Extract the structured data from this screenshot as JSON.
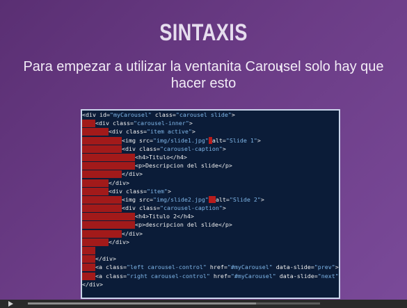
{
  "slide": {
    "title": "SINTAXIS",
    "subtitle_line1": "Para empezar a utilizar la ventanita Carousel solo hay que",
    "subtitle_line2": "hacer esto"
  },
  "code": [
    {
      "indent": 0,
      "segments": [
        {
          "t": "<div id=",
          "c": "tag"
        },
        {
          "t": "\"myCarousel\"",
          "c": "str"
        },
        {
          "t": " class=",
          "c": "attr"
        },
        {
          "t": "\"carousel slide\"",
          "c": "str"
        },
        {
          "t": ">",
          "c": "tag"
        }
      ]
    },
    {
      "indent": 1,
      "segments": [
        {
          "t": "<div class=",
          "c": "tag"
        },
        {
          "t": "\"carousel-inner\"",
          "c": "str"
        },
        {
          "t": ">",
          "c": "tag"
        }
      ]
    },
    {
      "indent": 2,
      "segments": [
        {
          "t": "<div class=",
          "c": "tag"
        },
        {
          "t": "\"item active\"",
          "c": "str"
        },
        {
          "t": ">",
          "c": "tag"
        }
      ]
    },
    {
      "indent": 3,
      "segments": [
        {
          "t": "<img src=",
          "c": "tag"
        },
        {
          "t": "\"img/slide1.jpg\"",
          "c": "str"
        },
        {
          "t": " ",
          "c": "err"
        },
        {
          "t": "alt=",
          "c": "attr"
        },
        {
          "t": "\"Slide 1\"",
          "c": "str"
        },
        {
          "t": ">",
          "c": "tag"
        }
      ]
    },
    {
      "indent": 3,
      "segments": [
        {
          "t": "<div class=",
          "c": "tag"
        },
        {
          "t": "\"carousel-caption\"",
          "c": "str"
        },
        {
          "t": ">",
          "c": "tag"
        }
      ]
    },
    {
      "indent": 4,
      "segments": [
        {
          "t": "<h4>Titulo</h4>",
          "c": "tag"
        }
      ]
    },
    {
      "indent": 4,
      "segments": [
        {
          "t": "<p>Descripcion del slide</p>",
          "c": "tag"
        }
      ]
    },
    {
      "indent": 3,
      "segments": [
        {
          "t": "</div>",
          "c": "tag"
        }
      ]
    },
    {
      "indent": 2,
      "segments": [
        {
          "t": "</div>",
          "c": "tag"
        }
      ]
    },
    {
      "indent": 2,
      "segments": [
        {
          "t": "<div class=",
          "c": "tag"
        },
        {
          "t": "\"item\"",
          "c": "str"
        },
        {
          "t": ">",
          "c": "tag"
        }
      ]
    },
    {
      "indent": 3,
      "segments": [
        {
          "t": "<img src=",
          "c": "tag"
        },
        {
          "t": "\"img/slide2.jpg\"",
          "c": "str"
        },
        {
          "t": "  ",
          "c": "err"
        },
        {
          "t": "alt=",
          "c": "attr"
        },
        {
          "t": "\"Slide 2\"",
          "c": "str"
        },
        {
          "t": ">",
          "c": "tag"
        }
      ]
    },
    {
      "indent": 3,
      "segments": [
        {
          "t": "<div class=",
          "c": "tag"
        },
        {
          "t": "\"carousel-caption\"",
          "c": "str"
        },
        {
          "t": ">",
          "c": "tag"
        }
      ]
    },
    {
      "indent": 4,
      "segments": [
        {
          "t": "<h4>Titulo 2</h4>",
          "c": "tag"
        }
      ]
    },
    {
      "indent": 4,
      "segments": [
        {
          "t": "<p>descripcion del slide</p>",
          "c": "tag"
        }
      ]
    },
    {
      "indent": 3,
      "segments": [
        {
          "t": "</div>",
          "c": "tag"
        }
      ]
    },
    {
      "indent": 2,
      "segments": [
        {
          "t": "</div>",
          "c": "tag"
        }
      ]
    },
    {
      "indent": 1,
      "segments": []
    },
    {
      "indent": 1,
      "segments": [
        {
          "t": "</div>",
          "c": "tag"
        }
      ]
    },
    {
      "indent": 1,
      "segments": [
        {
          "t": "<a class=",
          "c": "tag"
        },
        {
          "t": "\"left carousel-control\"",
          "c": "str"
        },
        {
          "t": " href=",
          "c": "attr"
        },
        {
          "t": "\"#myCarousel\"",
          "c": "str"
        },
        {
          "t": " data-slide=",
          "c": "attr"
        },
        {
          "t": "\"prev\"",
          "c": "str"
        },
        {
          "t": ">‹</a>",
          "c": "tag"
        }
      ]
    },
    {
      "indent": 1,
      "segments": [
        {
          "t": "<a class=",
          "c": "tag"
        },
        {
          "t": "\"right carousel-control\"",
          "c": "str"
        },
        {
          "t": " href=",
          "c": "attr"
        },
        {
          "t": "\"#myCarousel\"",
          "c": "str"
        },
        {
          "t": " data-slide=",
          "c": "attr"
        },
        {
          "t": "\"next\"",
          "c": "str"
        },
        {
          "t": ">›</a>",
          "c": "tag"
        }
      ]
    },
    {
      "indent": 0,
      "segments": [
        {
          "t": "</div>",
          "c": "tag"
        }
      ]
    }
  ],
  "colors": {
    "background": "#6b3c86",
    "code_bg": "#0b1c38",
    "indent_marker": "#a21a1a",
    "string": "#7fb6e8"
  },
  "player": {
    "progress": 0.78,
    "play_icon": "play-icon"
  }
}
